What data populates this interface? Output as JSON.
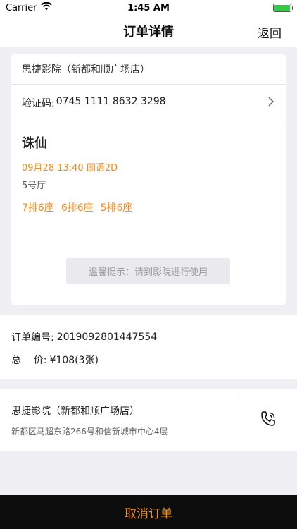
{
  "status_bar": {
    "carrier": "Carrier",
    "time": "1:45 AM"
  },
  "nav": {
    "title": "订单详情",
    "back_label": "返回"
  },
  "ticket": {
    "cinema_name": "思捷影院（新都和顺广场店）",
    "code_label": "验证码:",
    "code_value": "0745 1111 8632 3298",
    "movie_title": "诛仙",
    "showtime": "09月28 13:40 国语2D",
    "hall": "5号厅",
    "seats": [
      "7排6座",
      "6排6座",
      "5排6座"
    ],
    "tip": "温馨提示：请到影院进行使用"
  },
  "order": {
    "number_label": "订单编号:",
    "number_value": "2019092801447554",
    "total_label": "总    价:",
    "total_value": "¥108(3张)"
  },
  "address": {
    "cinema_name": "思捷影院（新都和顺广场店）",
    "detail": "新都区马超东路266号和信新城市中心4层"
  },
  "actions": {
    "cancel_label": "取消订单"
  },
  "colors": {
    "accent": "#f08c1c",
    "bottom_bar": "#0d0d0d",
    "background": "#efeff4"
  },
  "icons": {
    "signal": "wifi-icon",
    "battery": "battery-icon",
    "chevron": "chevron-right-icon",
    "phone": "phone-icon"
  }
}
